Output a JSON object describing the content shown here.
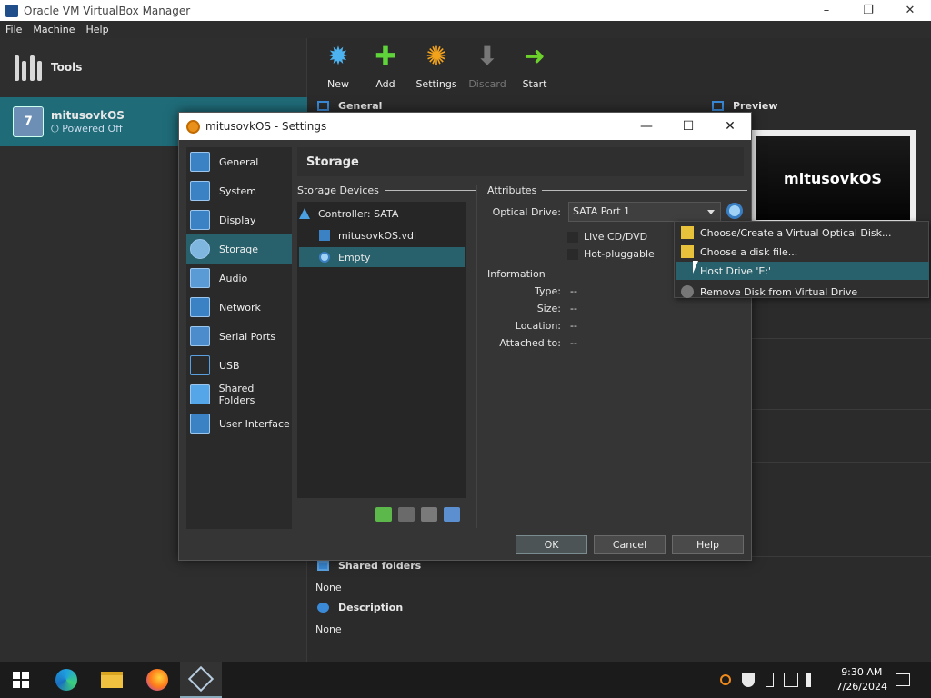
{
  "window": {
    "title": "Oracle VM VirtualBox Manager",
    "controls": [
      "–",
      "❐",
      "✕"
    ]
  },
  "menu": [
    "File",
    "Machine",
    "Help"
  ],
  "left": {
    "tools_label": "Tools",
    "vm": {
      "name": "mitusovkOS",
      "state": "Powered Off",
      "os_badge": "7"
    }
  },
  "toolbar": {
    "new": "New",
    "add": "Add",
    "settings": "Settings",
    "discard": "Discard",
    "start": "Start"
  },
  "details": {
    "general": "General",
    "preview": "Preview",
    "preview_text": "mitusovkOS",
    "shared_folders": "Shared folders",
    "shared_folders_value": "None",
    "description": "Description",
    "description_value": "None"
  },
  "dialog": {
    "title": "mitusovkOS - Settings",
    "controls": [
      "—",
      "☐",
      "✕"
    ],
    "categories": [
      "General",
      "System",
      "Display",
      "Storage",
      "Audio",
      "Network",
      "Serial Ports",
      "USB",
      "Shared Folders",
      "User Interface"
    ],
    "selected_category": "Storage",
    "page_title": "Storage",
    "storage_devices_label": "Storage Devices",
    "tree": {
      "controller": "Controller: SATA",
      "disk": "mitusovkOS.vdi",
      "optical": "Empty"
    },
    "attributes_label": "Attributes",
    "optical_drive_label": "Optical Drive:",
    "optical_drive_value": "SATA Port 1",
    "live_cd": "Live CD/DVD",
    "hot_pluggable": "Hot-pluggable",
    "information_label": "Information",
    "info": [
      {
        "label": "Type:",
        "value": "--"
      },
      {
        "label": "Size:",
        "value": "--"
      },
      {
        "label": "Location:",
        "value": "--"
      },
      {
        "label": "Attached to:",
        "value": "--"
      }
    ],
    "ok": "OK",
    "cancel": "Cancel",
    "help": "Help"
  },
  "popup": {
    "items": [
      "Choose/Create a Virtual Optical Disk...",
      "Choose a disk file...",
      "Host Drive 'E:'",
      "Remove Disk from Virtual Drive"
    ]
  },
  "taskbar": {
    "time": "9:30 AM",
    "date": "7/26/2024"
  },
  "colors": {
    "selection": "#28616c",
    "vm_item": "#1f6b78",
    "accent_blue": "#3a8ad8"
  }
}
